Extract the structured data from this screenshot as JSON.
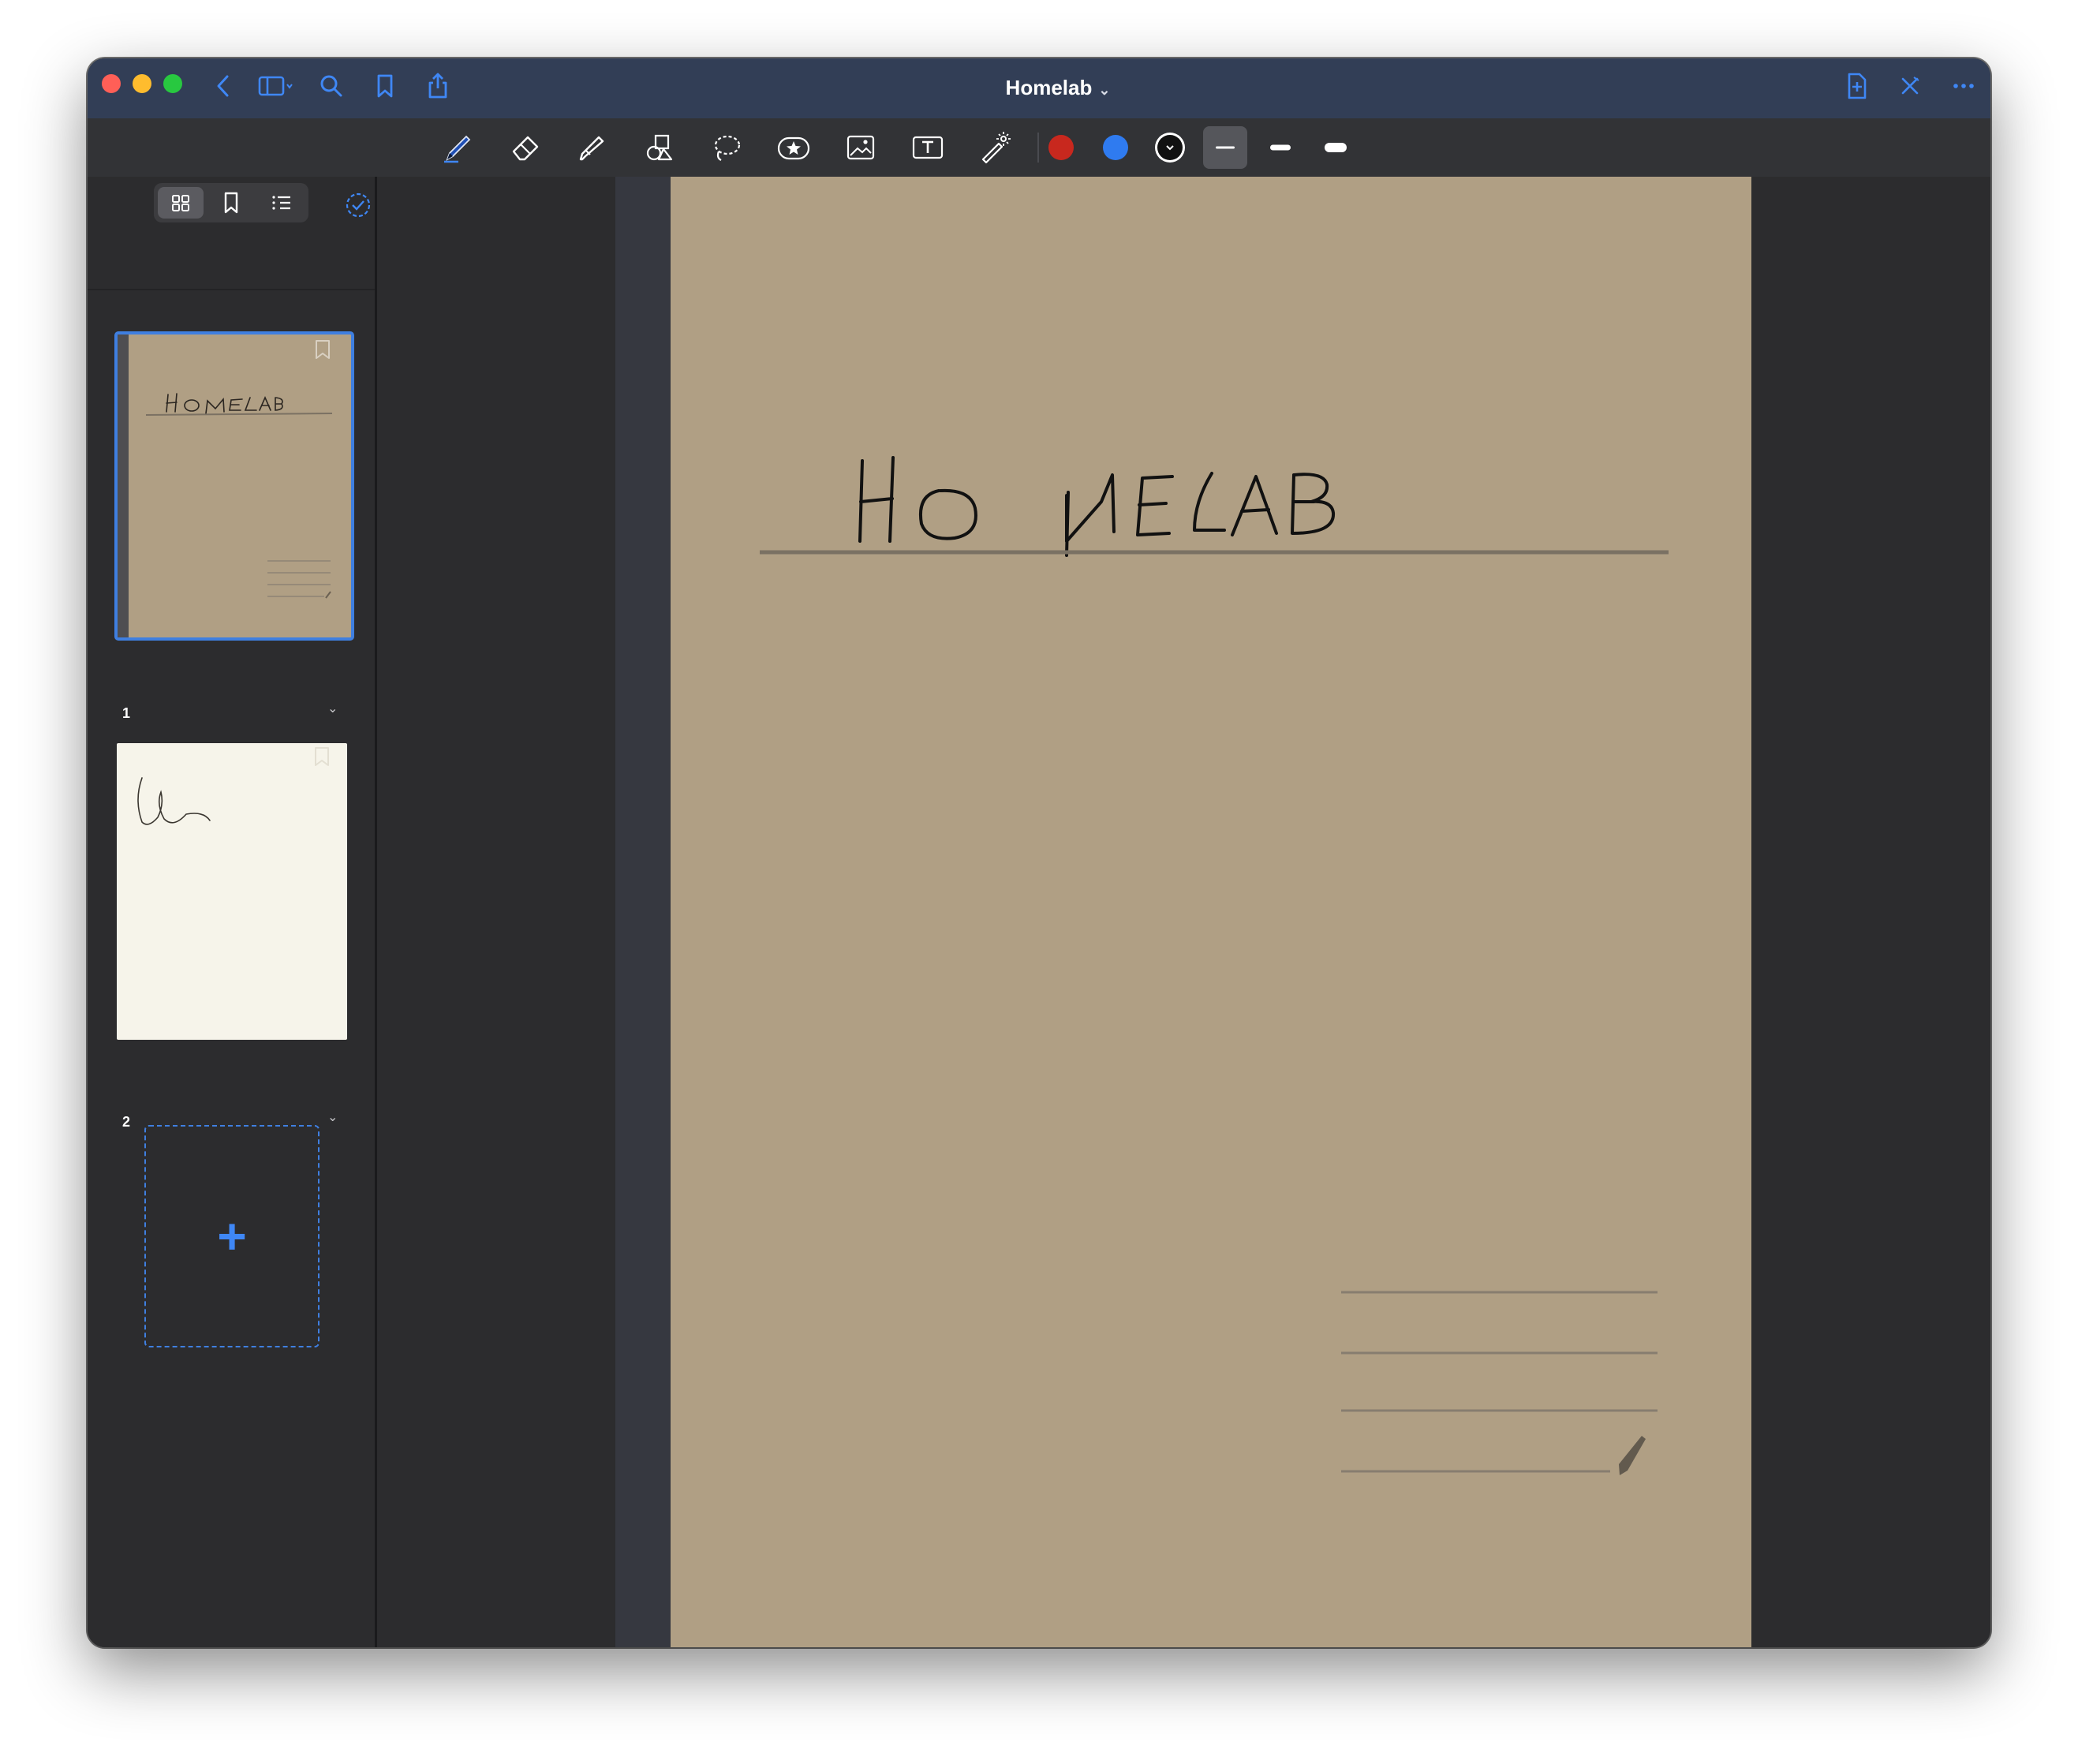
{
  "window": {
    "title": "Homelab",
    "title_chevron": "⌄"
  },
  "titlebar_icons": {
    "left": [
      "back-icon",
      "sidebar-toggle-icon",
      "search-icon",
      "bookmark-icon",
      "share-icon"
    ],
    "right": [
      "add-page-icon",
      "close-tools-icon",
      "more-icon"
    ]
  },
  "toolbar": {
    "tools": [
      "pen",
      "eraser",
      "highlighter",
      "shapes",
      "lasso",
      "sticker",
      "image",
      "text-box",
      "laser-pointer"
    ],
    "selected_tool": "pen",
    "colors": [
      "#c8281e",
      "#2f7bf0",
      "#111111"
    ],
    "stroke_widths": [
      "thin",
      "medium",
      "thick"
    ],
    "selected_stroke": "thin"
  },
  "sidebar": {
    "view_modes": [
      "thumbnails",
      "bookmarks",
      "outline"
    ],
    "active_view": "thumbnails",
    "pages": [
      {
        "number": "1",
        "selected": true,
        "background": "#b09f84",
        "chevron": "⌄"
      },
      {
        "number": "2",
        "selected": false,
        "background": "#f6f4ea",
        "chevron": "⌄"
      }
    ],
    "add_page_symbol": "+"
  },
  "page": {
    "background": "#b09f84",
    "handwritten_title": "HOMELAB"
  },
  "accent_color": "#3f87f5"
}
